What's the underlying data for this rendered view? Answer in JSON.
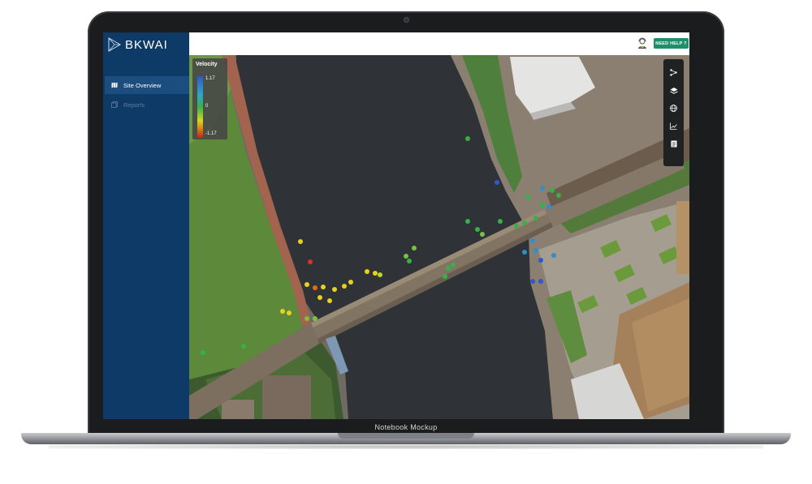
{
  "app": {
    "logo_text": "BKWAI"
  },
  "sidebar": {
    "items": [
      {
        "label": "Site Overview",
        "icon": "map-icon",
        "active": true
      },
      {
        "label": "Reports",
        "icon": "reports-icon",
        "active": false
      }
    ]
  },
  "header": {
    "help_label": "NEED HELP ?"
  },
  "legend": {
    "title": "Velocity",
    "max": "1.17",
    "mid": "0",
    "min": "-1.17"
  },
  "device": {
    "label": "Notebook Mockup"
  },
  "colors": {
    "sidebar": "#0d3a66",
    "sidebar_active": "#1c4d7f",
    "help_button": "#1e8f6a",
    "velocity_high": "#2f58c8",
    "velocity_zero": "#38b04a",
    "velocity_low": "#d02014"
  },
  "map_tools": [
    "connect-icon",
    "layers-icon",
    "globe-icon",
    "chart-icon",
    "document-icon"
  ],
  "map_rail_icons": [
    "back-arrow-icon",
    "bell-icon",
    "layers-icon",
    "satellite-icon",
    "trend-icon"
  ]
}
